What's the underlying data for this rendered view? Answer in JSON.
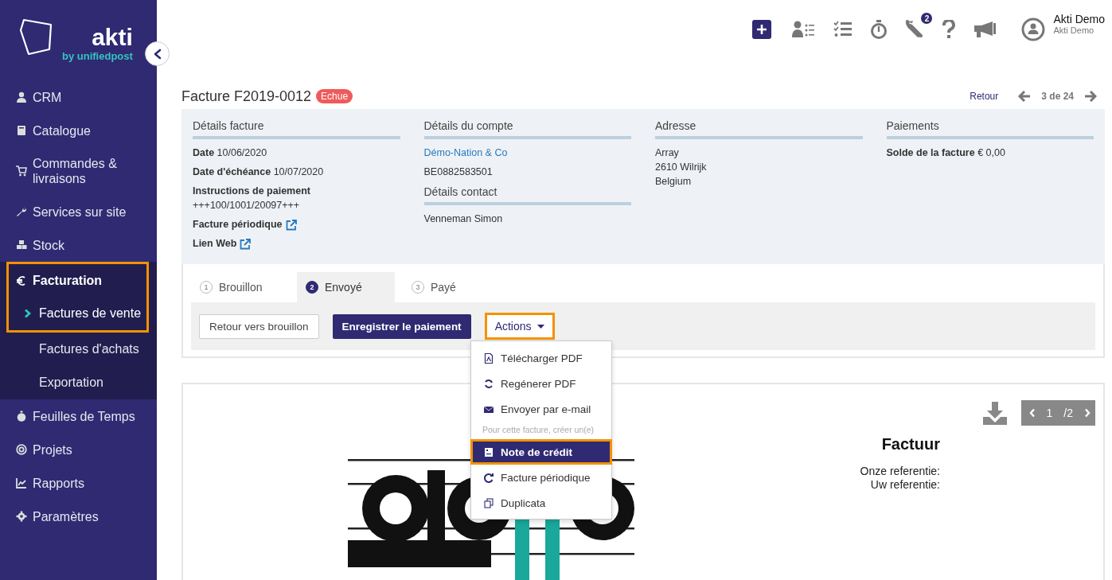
{
  "brand": {
    "name": "akti",
    "tagline": "by unifiedpost"
  },
  "sidebar": {
    "items": [
      {
        "label": "CRM",
        "selected": false,
        "highlighted": false
      },
      {
        "label": "Catalogue",
        "selected": false,
        "highlighted": false
      },
      {
        "label": "Commandes & livraisons",
        "selected": false,
        "highlighted": false
      },
      {
        "label": "Services sur site",
        "selected": false,
        "highlighted": false
      },
      {
        "label": "Stock",
        "selected": false,
        "highlighted": false
      },
      {
        "label": "Facturation",
        "selected": true,
        "highlighted": true,
        "expanded": true,
        "children": [
          {
            "label": "Factures de vente",
            "selected": true,
            "highlighted": true
          },
          {
            "label": "Factures d'achats",
            "selected": false,
            "highlighted": false
          },
          {
            "label": "Exportation",
            "selected": false,
            "highlighted": false
          }
        ]
      },
      {
        "label": "Feuilles de Temps",
        "selected": false,
        "highlighted": false
      },
      {
        "label": "Projets",
        "selected": false,
        "highlighted": false
      },
      {
        "label": "Rapports",
        "selected": false,
        "highlighted": false
      },
      {
        "label": "Paramètres",
        "selected": false,
        "highlighted": false
      }
    ]
  },
  "topbar": {
    "notification_badge": "2",
    "user": {
      "name": "Akti Demo",
      "company": "Akti Demo"
    }
  },
  "header": {
    "title": "Facture F2019-0012",
    "status": "Echue",
    "back": "Retour",
    "position": "3 de 24"
  },
  "details": {
    "columns": [
      {
        "sections": [
          {
            "title": "Détails facture",
            "rows": [
              {
                "kind": "field",
                "label": "Date",
                "value": "10/06/2020"
              },
              {
                "kind": "field",
                "label": "Date d'échéance",
                "value": "10/07/2020"
              },
              {
                "kind": "field_block",
                "label": "Instructions de paiement",
                "value": "+++100/1001/20097+++"
              },
              {
                "kind": "external",
                "label": "Facture périodique"
              },
              {
                "kind": "external",
                "label": "Lien Web"
              }
            ]
          }
        ]
      },
      {
        "sections": [
          {
            "title": "Détails du compte",
            "rows": [
              {
                "kind": "link",
                "value": "Démo-Nation & Co"
              },
              {
                "kind": "text",
                "value": "BE0882583501"
              }
            ]
          },
          {
            "title": "Détails contact",
            "rows": [
              {
                "kind": "text",
                "value": "Venneman Simon"
              }
            ]
          }
        ]
      },
      {
        "sections": [
          {
            "title": "Adresse",
            "rows": [
              {
                "kind": "line",
                "value": "Array"
              },
              {
                "kind": "line",
                "value": "2610 Wilrijk"
              },
              {
                "kind": "line",
                "value": "Belgium"
              }
            ]
          }
        ]
      },
      {
        "sections": [
          {
            "title": "Paiements",
            "rows": [
              {
                "kind": "field",
                "label": "Solde de la facture",
                "value": "€ 0,00"
              }
            ]
          }
        ]
      }
    ]
  },
  "steps": [
    {
      "number": "1",
      "label": "Brouillon",
      "selected": false
    },
    {
      "number": "2",
      "label": "Envoyé",
      "selected": true
    },
    {
      "number": "3",
      "label": "Payé",
      "selected": false
    }
  ],
  "actions": {
    "back_to_draft": "Retour vers brouillon",
    "register_payment": "Enregistrer le paiement",
    "menu_button": "Actions",
    "highlighted": true,
    "expanded": true
  },
  "actions_menu": [
    {
      "kind": "item",
      "label": "Télécharger PDF",
      "selected": false,
      "highlighted": false
    },
    {
      "kind": "item",
      "label": "Regénerer PDF",
      "selected": false,
      "highlighted": false
    },
    {
      "kind": "item",
      "label": "Envoyer par e-mail",
      "selected": false,
      "highlighted": false
    },
    {
      "kind": "header",
      "label": "Pour cette facture, créer un(e)"
    },
    {
      "kind": "item",
      "label": "Note de crédit",
      "selected": true,
      "highlighted": true
    },
    {
      "kind": "item",
      "label": "Facture périodique",
      "selected": false,
      "highlighted": false
    },
    {
      "kind": "item",
      "label": "Duplicata",
      "selected": false,
      "highlighted": false
    }
  ],
  "preview": {
    "page": "1",
    "pages": "/2",
    "title": "Factuur",
    "lines": [
      "Onze referentie:",
      "Uw referentie:"
    ],
    "logo": {
      "kind": "picture"
    }
  }
}
